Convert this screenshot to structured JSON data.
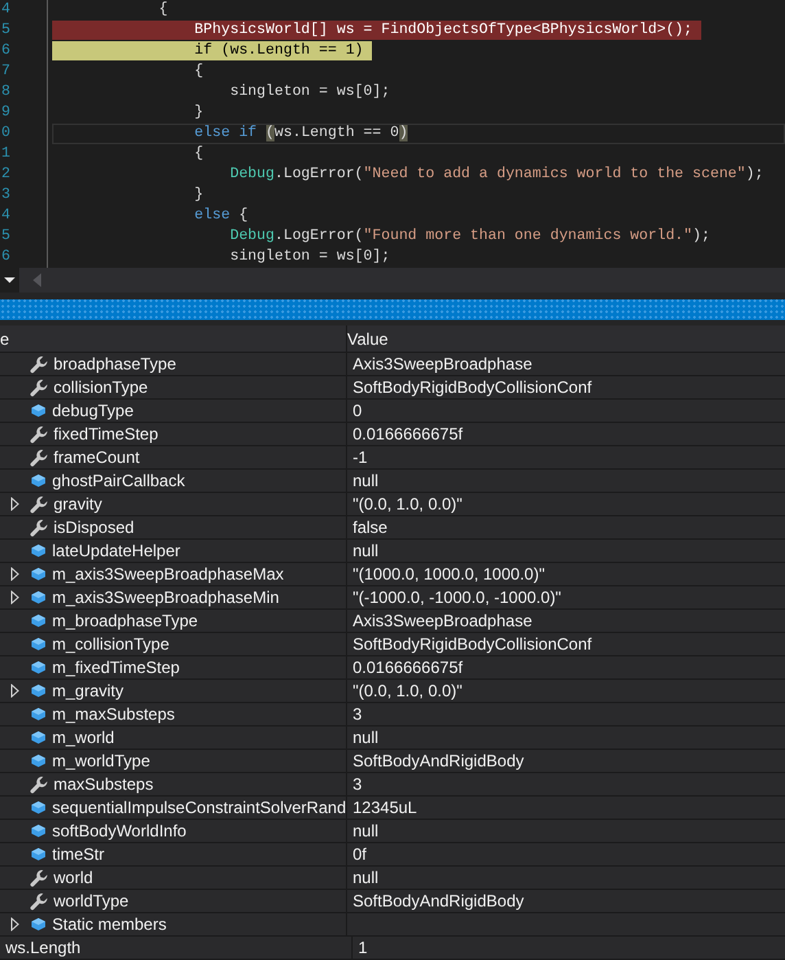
{
  "editor": {
    "lines": [
      {
        "number": "4",
        "breakpoint": false,
        "current": false,
        "tokens": [
          {
            "kind": "plain",
            "text": "            {"
          }
        ]
      },
      {
        "number": "5",
        "breakpoint": true,
        "current": false,
        "tokens": [
          {
            "kind": "plain",
            "text": "                BPhysicsWorld[] ws = FindObjectsOfType<BPhysicsWorld>();"
          }
        ]
      },
      {
        "number": "6",
        "breakpoint": false,
        "current": true,
        "tokens": [
          {
            "kind": "plain",
            "text": "                if (ws.Length == 1)"
          }
        ]
      },
      {
        "number": "7",
        "breakpoint": false,
        "current": false,
        "tokens": [
          {
            "kind": "plain",
            "text": "                {"
          }
        ]
      },
      {
        "number": "8",
        "breakpoint": false,
        "current": false,
        "tokens": [
          {
            "kind": "plain",
            "text": "                    singleton = ws[0];"
          }
        ]
      },
      {
        "number": "9",
        "breakpoint": false,
        "current": false,
        "tokens": [
          {
            "kind": "plain",
            "text": "                }"
          }
        ]
      },
      {
        "number": "0",
        "breakpoint": false,
        "current": false,
        "tokens": [
          {
            "kind": "keyword",
            "text": "                else if "
          },
          {
            "kind": "match",
            "text": "("
          },
          {
            "kind": "plain",
            "text": "ws.Length == 0"
          },
          {
            "kind": "match",
            "text": ")"
          }
        ]
      },
      {
        "number": "1",
        "breakpoint": false,
        "current": false,
        "tokens": [
          {
            "kind": "plain",
            "text": "                {"
          }
        ]
      },
      {
        "number": "2",
        "breakpoint": false,
        "current": false,
        "tokens": [
          {
            "kind": "type",
            "text": "                    Debug"
          },
          {
            "kind": "plain",
            "text": ".LogError("
          },
          {
            "kind": "string",
            "text": "\"Need to add a dynamics world to the scene\""
          },
          {
            "kind": "plain",
            "text": ");"
          }
        ]
      },
      {
        "number": "3",
        "breakpoint": false,
        "current": false,
        "tokens": [
          {
            "kind": "plain",
            "text": "                }"
          }
        ]
      },
      {
        "number": "4",
        "breakpoint": false,
        "current": false,
        "tokens": [
          {
            "kind": "keyword",
            "text": "                else "
          },
          {
            "kind": "plain",
            "text": "{"
          }
        ]
      },
      {
        "number": "5",
        "breakpoint": false,
        "current": false,
        "tokens": [
          {
            "kind": "type",
            "text": "                    Debug"
          },
          {
            "kind": "plain",
            "text": ".LogError("
          },
          {
            "kind": "string",
            "text": "\"Found more than one dynamics world.\""
          },
          {
            "kind": "plain",
            "text": ");"
          }
        ]
      },
      {
        "number": "6",
        "breakpoint": false,
        "current": false,
        "tokens": [
          {
            "kind": "plain",
            "text": "                    singleton = ws[0];"
          }
        ]
      }
    ]
  },
  "watch": {
    "columns": [
      "e",
      "Value"
    ],
    "rows": [
      {
        "kind": "property",
        "expandable": false,
        "name": "broadphaseType",
        "value": "Axis3SweepBroadphase"
      },
      {
        "kind": "property",
        "expandable": false,
        "name": "collisionType",
        "value": "SoftBodyRigidBodyCollisionConf"
      },
      {
        "kind": "field",
        "expandable": false,
        "name": "debugType",
        "value": "0"
      },
      {
        "kind": "property",
        "expandable": false,
        "name": "fixedTimeStep",
        "value": "0.0166666675f"
      },
      {
        "kind": "property",
        "expandable": false,
        "name": "frameCount",
        "value": "-1"
      },
      {
        "kind": "field",
        "expandable": false,
        "name": "ghostPairCallback",
        "value": "null"
      },
      {
        "kind": "property",
        "expandable": true,
        "name": "gravity",
        "value": "\"(0.0, 1.0, 0.0)\""
      },
      {
        "kind": "property",
        "expandable": false,
        "name": "isDisposed",
        "value": "false"
      },
      {
        "kind": "field",
        "expandable": false,
        "name": "lateUpdateHelper",
        "value": "null"
      },
      {
        "kind": "field",
        "expandable": true,
        "name": "m_axis3SweepBroadphaseMax",
        "value": "\"(1000.0, 1000.0, 1000.0)\""
      },
      {
        "kind": "field",
        "expandable": true,
        "name": "m_axis3SweepBroadphaseMin",
        "value": "\"(-1000.0, -1000.0, -1000.0)\""
      },
      {
        "kind": "field",
        "expandable": false,
        "name": "m_broadphaseType",
        "value": "Axis3SweepBroadphase"
      },
      {
        "kind": "field",
        "expandable": false,
        "name": "m_collisionType",
        "value": "SoftBodyRigidBodyCollisionConf"
      },
      {
        "kind": "field",
        "expandable": false,
        "name": "m_fixedTimeStep",
        "value": "0.0166666675f"
      },
      {
        "kind": "field",
        "expandable": true,
        "name": "m_gravity",
        "value": "\"(0.0, 1.0, 0.0)\""
      },
      {
        "kind": "field",
        "expandable": false,
        "name": "m_maxSubsteps",
        "value": "3"
      },
      {
        "kind": "field",
        "expandable": false,
        "name": "m_world",
        "value": "null"
      },
      {
        "kind": "field",
        "expandable": false,
        "name": "m_worldType",
        "value": "SoftBodyAndRigidBody"
      },
      {
        "kind": "property",
        "expandable": false,
        "name": "maxSubsteps",
        "value": "3"
      },
      {
        "kind": "field",
        "expandable": false,
        "name": "sequentialImpulseConstraintSolverRand",
        "value": "12345uL"
      },
      {
        "kind": "field",
        "expandable": false,
        "name": "softBodyWorldInfo",
        "value": "null"
      },
      {
        "kind": "field",
        "expandable": false,
        "name": "timeStr",
        "value": "0f"
      },
      {
        "kind": "property",
        "expandable": false,
        "name": "world",
        "value": "null"
      },
      {
        "kind": "property",
        "expandable": false,
        "name": "worldType",
        "value": "SoftBodyAndRigidBody"
      },
      {
        "kind": "field",
        "expandable": true,
        "name": "Static members"
      },
      {
        "kind": "watch",
        "expandable": false,
        "name": "ws.Length",
        "value": "1"
      }
    ]
  }
}
